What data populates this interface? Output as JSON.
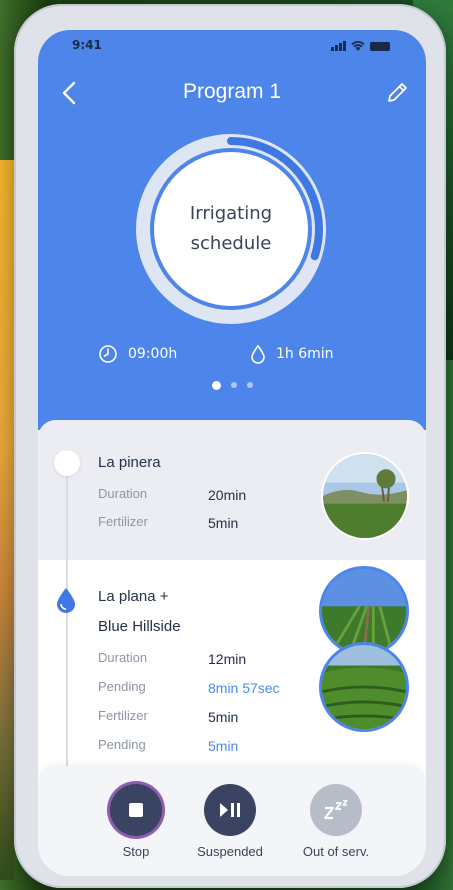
{
  "status_bar": {
    "time": "9:41"
  },
  "header": {
    "title": "Program 1"
  },
  "progress": {
    "label_line1": "Irrigating",
    "label_line2": "schedule",
    "fraction": 0.3
  },
  "meta": {
    "start_time": "09:00h",
    "water_duration": "1h 6min"
  },
  "pager": {
    "count": 3,
    "active": 0
  },
  "zones": [
    {
      "name": "La pinera",
      "rows": [
        {
          "label": "Duration",
          "value": "20min"
        },
        {
          "label": "Fertilizer",
          "value": "5min"
        }
      ]
    },
    {
      "name_line1": "La plana +",
      "name_line2": "Blue Hillside",
      "rows": [
        {
          "label": "Duration",
          "value": "12min"
        },
        {
          "label": "Pending",
          "value": "8min 57sec"
        },
        {
          "label": "Fertilizer",
          "value": "5min"
        },
        {
          "label": "Pending",
          "value": "5min"
        }
      ]
    }
  ],
  "controls": {
    "stop": "Stop",
    "suspended": "Suspended",
    "out_of_service": "Out of serv."
  },
  "colors": {
    "accent": "#4e85ea",
    "pending": "#4a8af0",
    "dark_button": "#3a4361"
  }
}
